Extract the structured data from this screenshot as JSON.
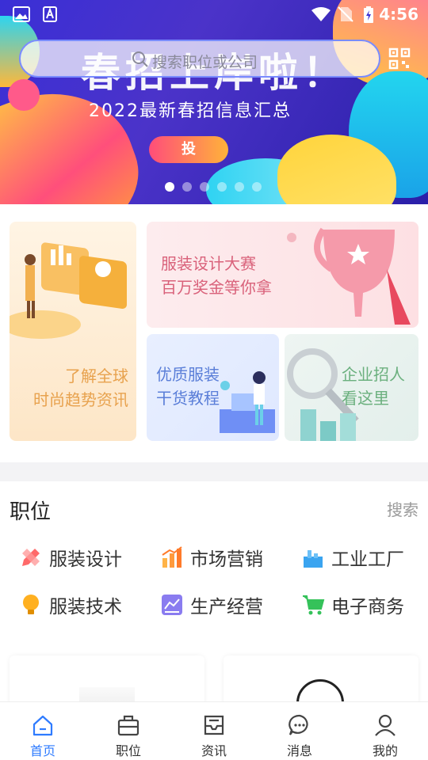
{
  "status_bar": {
    "time": "4:56"
  },
  "search": {
    "placeholder": "搜索职位或公司"
  },
  "banner": {
    "title": "春招上岸啦！",
    "subtitle": "2022最新春招信息汇总",
    "button_label": "投",
    "dot_count": 6,
    "active_dot": 0
  },
  "features": {
    "global_trends": {
      "line1": "了解全球",
      "line2": "时尚趋势资讯"
    },
    "design_contest": {
      "line1": "服装设计大赛",
      "line2": "百万奖金等你拿"
    },
    "tutorials": {
      "line1": "优质服装",
      "line2": "干货教程"
    },
    "recruit": {
      "line1": "企业招人",
      "line2": "看这里"
    }
  },
  "jobs": {
    "title": "职位",
    "search_label": "搜索",
    "categories": [
      {
        "label": "服装设计",
        "icon": "pencil-ruler-icon",
        "color": "#ff6a6a"
      },
      {
        "label": "市场营销",
        "icon": "bar-chart-icon",
        "color": "#ff9a3c"
      },
      {
        "label": "工业工厂",
        "icon": "factory-icon",
        "color": "#3aa4f0"
      },
      {
        "label": "服装技术",
        "icon": "lightbulb-icon",
        "color": "#ffb020"
      },
      {
        "label": "生产经营",
        "icon": "production-icon",
        "color": "#8a7cf0"
      },
      {
        "label": "电子商务",
        "icon": "cart-icon",
        "color": "#35c25a"
      }
    ]
  },
  "bottom_nav": {
    "items": [
      {
        "label": "首页",
        "icon": "home-icon",
        "active": true
      },
      {
        "label": "职位",
        "icon": "briefcase-icon",
        "active": false
      },
      {
        "label": "资讯",
        "icon": "inbox-icon",
        "active": false
      },
      {
        "label": "消息",
        "icon": "message-icon",
        "active": false
      },
      {
        "label": "我的",
        "icon": "user-icon",
        "active": false
      }
    ]
  },
  "colors": {
    "accent": "#2e7bff",
    "banner_bg": "#3a2fd6"
  }
}
